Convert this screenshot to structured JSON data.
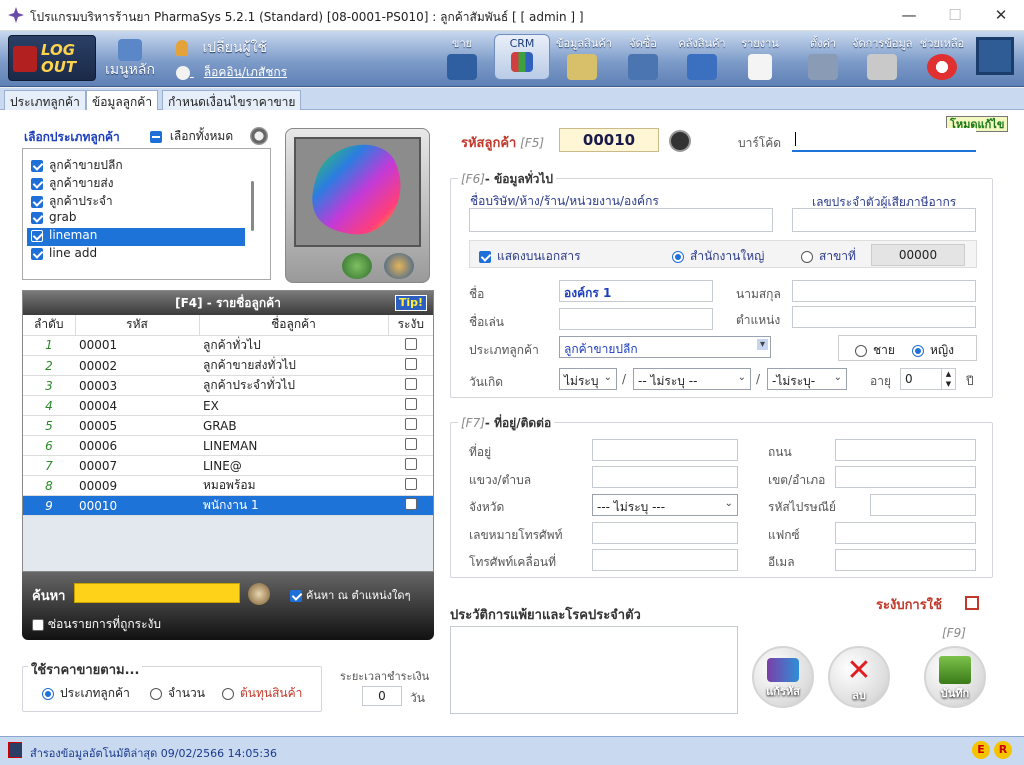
{
  "window": {
    "title": "โปรแกรมบริหารร้านยา PharmaSys 5.2.1 (Standard) [08-0001-PS010] : ลูกค้าสัมพันธ์  [ [ admin ] ]"
  },
  "toolbar": {
    "logout": "LOG OUT",
    "home": "เมนูหลัก",
    "switch_user": "เปลี่ยนผู้ใช้",
    "login_staff": "ล็อคอิน/เภสัชกร",
    "buttons": [
      "ขาย",
      "CRM",
      "ข้อมูลสินค้า",
      "จัดซื้อ",
      "คลังสินค้า",
      "รายงาน",
      "ตั้งค่า",
      "จัดการข้อมูล",
      "ช่วยเหลือ"
    ]
  },
  "tabs": [
    "ประเภทลูกค้า",
    "ข้อมูลลูกค้า",
    "กำหนดเงื่อนไขราคาขาย"
  ],
  "left": {
    "group_title": "เลือกประเภทลูกค้า",
    "select_all": "เลือกทั้งหมด",
    "groups": [
      "ลูกค้าขายปลีก",
      "ลูกค้าขายส่ง",
      "ลูกค้าประจำ",
      "grab",
      "lineman",
      "line add"
    ],
    "list_title": "[F4] - รายชื่อลูกค้า",
    "tip": "Tip!",
    "columns": [
      "ลำดับ",
      "รหัส",
      "ชื่อลูกค้า",
      "ระงับ"
    ],
    "rows": [
      {
        "no": "1",
        "code": "00001",
        "name": "ลูกค้าทั่วไป"
      },
      {
        "no": "2",
        "code": "00002",
        "name": "ลูกค้าขายส่งทั่วไป"
      },
      {
        "no": "3",
        "code": "00003",
        "name": "ลูกค้าประจำทั่วไป"
      },
      {
        "no": "4",
        "code": "00004",
        "name": "EX"
      },
      {
        "no": "5",
        "code": "00005",
        "name": "GRAB"
      },
      {
        "no": "6",
        "code": "00006",
        "name": "LINEMAN"
      },
      {
        "no": "7",
        "code": "00007",
        "name": "LINE@"
      },
      {
        "no": "8",
        "code": "00009",
        "name": "หมอพร้อม"
      },
      {
        "no": "9",
        "code": "00010",
        "name": "พนักงาน 1"
      }
    ],
    "search_label": "ค้นหา",
    "search_anywhere": "ค้นหา ณ ตำแหน่งใดๆ",
    "hide_suspended": "ซ่อนรายการที่ถูกระงับ",
    "price_title": "ใช้ราคาขายตาม...",
    "price_options": [
      "ประเภทลูกค้า",
      "จำนวน",
      "ต้นทุนสินค้า"
    ],
    "payment_term": "ระยะเวลาชำระเงิน",
    "payment_days": "0",
    "days_unit": "วัน"
  },
  "form": {
    "mode_badge": "โหมดแก้ไข",
    "code_label": "รหัสลูกค้า",
    "code_key": "[F5]",
    "code_value": "00010",
    "barcode_label": "บาร์โค้ด",
    "general_key": "[F6]",
    "general_title": "- ข้อมูลทั่วไป",
    "company_label": "ชื่อบริษัท/ห้าง/ร้าน/หน่วยงาน/องค์กร",
    "taxid_label": "เลขประจำตัวผู้เสียภาษีอากร",
    "show_on_doc": "แสดงบนเอกสาร",
    "head_office": "สำนักงานใหญ่",
    "branch": "สาขาที่",
    "branch_no": "00000",
    "first_name_label": "ชื่อ",
    "first_name": "องค์กร 1",
    "last_name_label": "นามสกุล",
    "nickname_label": "ชื่อเล่น",
    "position_label": "ตำแหน่ง",
    "cust_type_label": "ประเภทลูกค้า",
    "cust_type_value": "ลูกค้าขายปลีก",
    "male": "ชาย",
    "female": "หญิง",
    "birthday_label": "วันเกิด",
    "bday_day": "ไม่ระบุ",
    "bday_month": "-- ไม่ระบุ --",
    "bday_year": "-ไม่ระบุ-",
    "age_label": "อายุ",
    "age_value": "0",
    "age_unit": "ปี",
    "address_key": "[F7]",
    "address_title": "- ที่อยู่/ติดต่อ",
    "addr_label": "ที่อยู่",
    "road_label": "ถนน",
    "subdistrict_label": "แขวง/ตำบล",
    "district_label": "เขต/อำเภอ",
    "province_label": "จังหวัด",
    "province_value": "--- ไม่ระบุ ---",
    "postcode_label": "รหัสไปรษณีย์",
    "phone_label": "เลขหมายโทรศัพท์",
    "fax_label": "แฟกซ์",
    "mobile_label": "โทรศัพท์เคลื่อนที่",
    "email_label": "อีเมล",
    "allergy_label": "ประวัติการแพ้ยาและโรคประจำตัว",
    "suspend_label": "ระงับการใช้",
    "save_key": "[F9]",
    "edit_code": "แก้รหัส",
    "delete": "ลบ",
    "save": "บันทึก"
  },
  "status": {
    "text": "สำรองข้อมูลอัตโนมัติล่าสุด  09/02/2566 14:05:36"
  }
}
